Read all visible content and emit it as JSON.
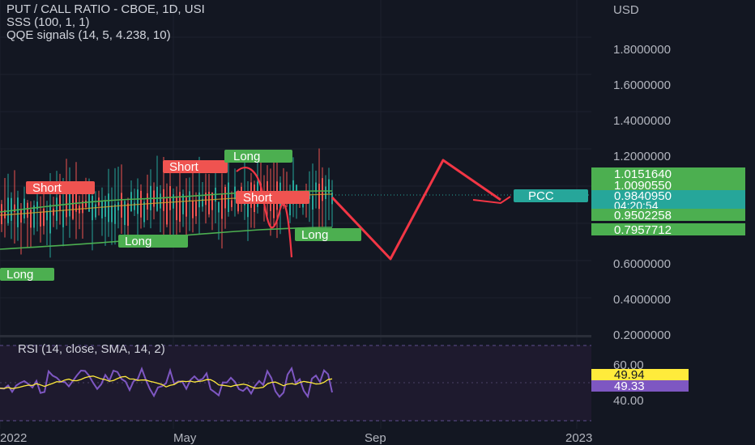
{
  "header": {
    "title": "PUT / CALL RATIO - CBOE, 1D, USI",
    "indicator_1": "SSS (100, 1, 1)",
    "indicator_2": "QQE signals (14, 5, 4.238, 10)"
  },
  "price_axis": {
    "currency": "USD",
    "ticks": [
      "1.8000000",
      "1.6000000",
      "1.4000000",
      "1.2000000",
      "0.6000000",
      "0.4000000",
      "0.2000000"
    ],
    "tick_values": [
      1.8,
      1.6,
      1.4,
      1.2,
      0.6,
      0.4,
      0.2
    ],
    "labels": [
      {
        "text": "1.0151640",
        "color": "#4caf50",
        "value": 1.015164
      },
      {
        "text": "1.0090550",
        "color": "#4caf50",
        "value": 1.009055
      },
      {
        "text": "0.9840950",
        "color": "#26a69a",
        "value": 0.984095
      },
      {
        "text": "04:20:54",
        "color": "#26a69a"
      },
      {
        "text": "0.9502258",
        "color": "#4caf50",
        "value": 0.9502258
      },
      {
        "text": "0.7957712",
        "color": "#4caf50",
        "value": 0.7957712
      }
    ]
  },
  "pcc_label": "PCC",
  "signals": [
    {
      "text": "Long",
      "kind": "long"
    },
    {
      "text": "Short",
      "kind": "short"
    },
    {
      "text": "Long",
      "kind": "long"
    },
    {
      "text": "Short",
      "kind": "short"
    },
    {
      "text": "Long",
      "kind": "long"
    },
    {
      "text": "Short",
      "kind": "short"
    },
    {
      "text": "Long",
      "kind": "long"
    }
  ],
  "rsi": {
    "title": "RSI (14, close, SMA, 14, 2)",
    "ticks": [
      "60.00",
      "40.00"
    ],
    "tick_values": [
      60,
      40
    ],
    "value_labels": [
      {
        "text": "49.94",
        "color": "#ffeb3b"
      },
      {
        "text": "49.33",
        "color": "#7e57c2"
      }
    ]
  },
  "time_axis": [
    "2022",
    "May",
    "Sep",
    "2023"
  ],
  "colors": {
    "background": "#131722",
    "up": "#26a69a",
    "down": "#ef5350",
    "long": "#4caf50",
    "short": "#ef5350",
    "drawing": "#f23645",
    "rsi_line": "#7e57c2",
    "rsi_ma": "#ffeb3b"
  },
  "chart_data": {
    "type": "line",
    "title": "PUT / CALL RATIO - CBOE, 1D, USI",
    "ylabel": "USD",
    "ylim": [
      0.2,
      2.0
    ],
    "x": [
      "2022",
      "May",
      "Sep",
      "2023"
    ],
    "series": [
      {
        "name": "PUT / CALL RATIO",
        "values": [
          0.92,
          0.88,
          0.95,
          0.9,
          0.98,
          0.93,
          1.01,
          0.96,
          0.89,
          0.94,
          0.99,
          0.92,
          0.97,
          0.95,
          0.98
        ]
      },
      {
        "name": "SSS (100, 1, 1)",
        "values": [
          0.87,
          0.87,
          0.88,
          0.89,
          0.9,
          0.91,
          0.92,
          0.93,
          0.94,
          0.95,
          0.96,
          0.97,
          0.98,
          0.98,
          0.98
        ]
      }
    ],
    "last_price": 0.984095,
    "projection": [
      0.98,
      0.62,
      1.17,
      0.95
    ]
  }
}
